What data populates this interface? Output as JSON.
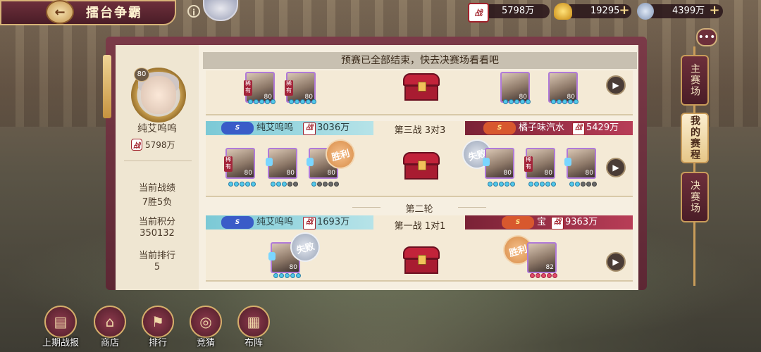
{
  "header": {
    "title": "擂台争霸",
    "back_icon": "back-arrow-icon",
    "info_glyph": "i"
  },
  "resources": [
    {
      "icon": "battle-power-icon",
      "glyph": "战",
      "value": "5798万",
      "has_plus": false
    },
    {
      "icon": "gold-ingot-icon",
      "glyph": "",
      "value": "19295",
      "has_plus": true
    },
    {
      "icon": "silver-coin-icon",
      "glyph": "",
      "value": "4399万",
      "has_plus": true
    }
  ],
  "notice": "预赛已全部结束，快去决赛场看看吧",
  "profile": {
    "level": "80",
    "name": "纯艾呜呜",
    "power": "5798万",
    "power_glyph": "战",
    "stats": [
      {
        "label": "当前战绩",
        "value": "7胜5负"
      },
      {
        "label": "当前积分",
        "value": "350132"
      },
      {
        "label": "当前排行",
        "value": "5"
      }
    ]
  },
  "matches": {
    "top_partial": {
      "left_heroes": [
        {
          "lv": "80",
          "tag": "稀有"
        },
        {
          "lv": "80",
          "tag": "稀有"
        }
      ],
      "right_heroes": [
        {
          "lv": "80"
        },
        {
          "lv": "80"
        }
      ]
    },
    "battle3": {
      "title": "第三战 3对3",
      "left": {
        "name": "纯艾呜呜",
        "power": "3036万",
        "result": "胜利"
      },
      "right": {
        "name": "橘子味汽水",
        "power": "5429万",
        "result": "失败"
      },
      "left_heroes": [
        {
          "lv": "80",
          "tag": "稀有"
        },
        {
          "lv": "80"
        },
        {
          "lv": "80"
        }
      ],
      "right_heroes": [
        {
          "lv": "80"
        },
        {
          "lv": "80",
          "tag": "稀有"
        },
        {
          "lv": "80"
        }
      ]
    },
    "round2": "第二轮",
    "battle1": {
      "title": "第一战 1对1",
      "left": {
        "name": "纯艾呜呜",
        "power": "1693万",
        "result": "失败"
      },
      "right": {
        "name": "宝",
        "power": "9363万",
        "result": "胜利"
      },
      "left_heroes": [
        {
          "lv": "80"
        }
      ],
      "right_heroes": [
        {
          "lv": "82"
        }
      ]
    },
    "zhan_glyph": "战"
  },
  "right_tabs": [
    {
      "label": "主赛场",
      "active": false
    },
    {
      "label": "我的赛程",
      "active": true
    },
    {
      "label": "决赛场",
      "active": false
    }
  ],
  "bottom_nav": [
    {
      "label": "上期战报",
      "icon": "scroll-icon"
    },
    {
      "label": "商店",
      "icon": "shop-icon"
    },
    {
      "label": "排行",
      "icon": "ranking-banner-icon"
    },
    {
      "label": "竞猜",
      "icon": "coins-icon"
    },
    {
      "label": "布阵",
      "icon": "formation-grid-icon"
    }
  ],
  "colors": {
    "panel": "#f6efe1",
    "frame": "#6d2f3b",
    "accent_gold": "#d7b378",
    "win": "#d78c47",
    "lose": "#9aa5b8"
  }
}
